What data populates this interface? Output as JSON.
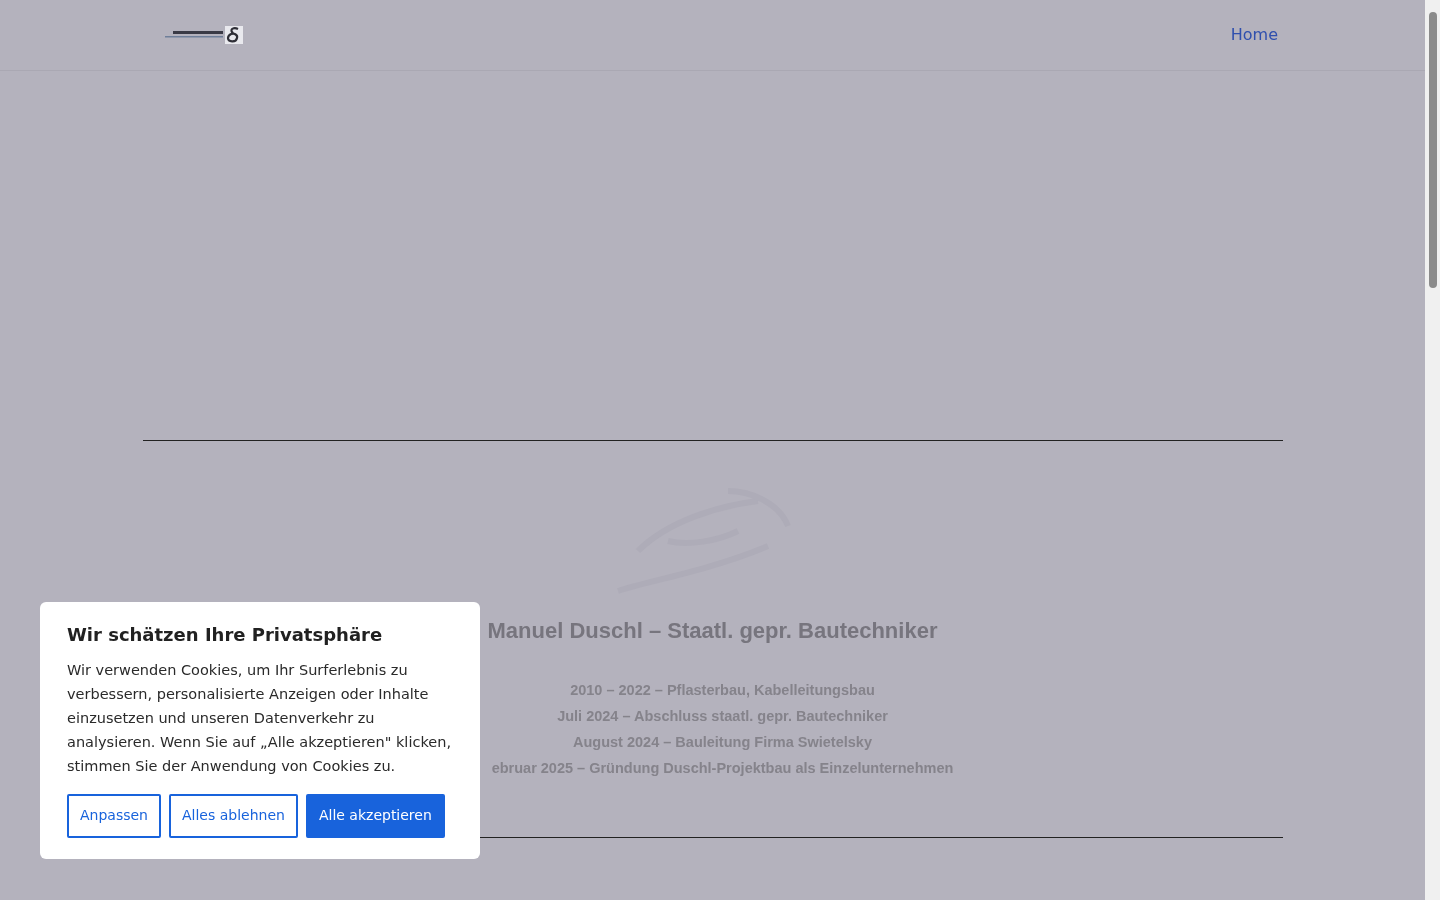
{
  "header": {
    "nav_links": [
      {
        "label": "Home"
      }
    ]
  },
  "profile": {
    "heading": "Manuel Duschl – Staatl. gepr. Bautechniker",
    "history": [
      "2010 – 2022 – Pflasterbau, Kabelleitungsbau",
      "Juli 2024 – Abschluss staatl. gepr. Bautechniker",
      "August 2024 – Bauleitung Firma Swietelsky",
      "ebruar 2025 – Gründung Duschl-Projektbau als Einzelunternehmen"
    ]
  },
  "cookie_banner": {
    "title": "Wir schätzen Ihre Privatsphäre",
    "text": "Wir verwenden Cookies, um Ihr Surferlebnis zu verbessern, personalisierte Anzeigen oder Inhalte einzusetzen und unseren Datenverkehr zu analysieren. Wenn Sie auf „Alle akzeptieren\" klicken, stimmen Sie der Anwendung von Cookies zu.",
    "buttons": [
      {
        "label": "Anpassen",
        "kind": "outline"
      },
      {
        "label": "Alles ablehnen",
        "kind": "outline"
      },
      {
        "label": "Alle akzeptieren",
        "kind": "primary"
      }
    ]
  }
}
